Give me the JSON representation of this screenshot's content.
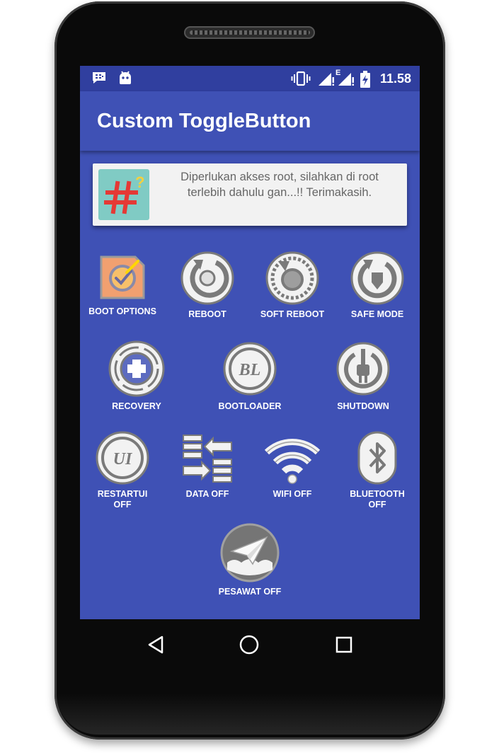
{
  "status_bar": {
    "time": "11.58",
    "network_type": "E",
    "icons": [
      "bbm-icon",
      "android-icon",
      "vibrate-icon",
      "signal-icon",
      "signal-icon",
      "battery-charging-icon"
    ]
  },
  "app_bar": {
    "title": "Custom ToggleButton"
  },
  "root_notice": {
    "icon": "hash-question-icon",
    "message": "Diperlukan akses root, silahkan di root terlebih dahulu gan...!! Terimakasih."
  },
  "toggles": {
    "boot_options": {
      "label": "BOOT OPTIONS",
      "icon": "boot-options-icon"
    },
    "reboot": {
      "label": "REBOOT",
      "icon": "reboot-icon"
    },
    "soft_reboot": {
      "label": "SOFT REBOOT",
      "icon": "soft-reboot-icon"
    },
    "safe_mode": {
      "label": "SAFE MODE",
      "icon": "safe-mode-icon"
    },
    "recovery": {
      "label": "RECOVERY",
      "icon": "recovery-icon"
    },
    "bootloader": {
      "label": "BOOTLOADER",
      "icon": "bootloader-icon",
      "icon_text": "BL"
    },
    "shutdown": {
      "label": "SHUTDOWN",
      "icon": "power-plug-icon"
    },
    "restart_ui": {
      "label": "RESTARTUI",
      "label2": "OFF",
      "icon": "restart-ui-icon",
      "icon_text": "UI"
    },
    "data": {
      "label": "DATA OFF",
      "icon": "data-transfer-icon"
    },
    "wifi": {
      "label": "WIFI OFF",
      "icon": "wifi-icon"
    },
    "bluetooth": {
      "label": "BLUETOOTH",
      "label2": "OFF",
      "icon": "bluetooth-icon"
    },
    "airplane": {
      "label": "PESAWAT OFF",
      "icon": "paper-plane-icon"
    }
  },
  "nav_bar": {
    "back": "back-icon",
    "home": "home-icon",
    "recents": "recents-icon"
  },
  "colors": {
    "primary": "#3f51b5",
    "primary_dark": "#303f9f",
    "card": "#f2f2f2",
    "icon_circle": "#f2f2f2",
    "icon_stroke": "#7a7a7a"
  }
}
